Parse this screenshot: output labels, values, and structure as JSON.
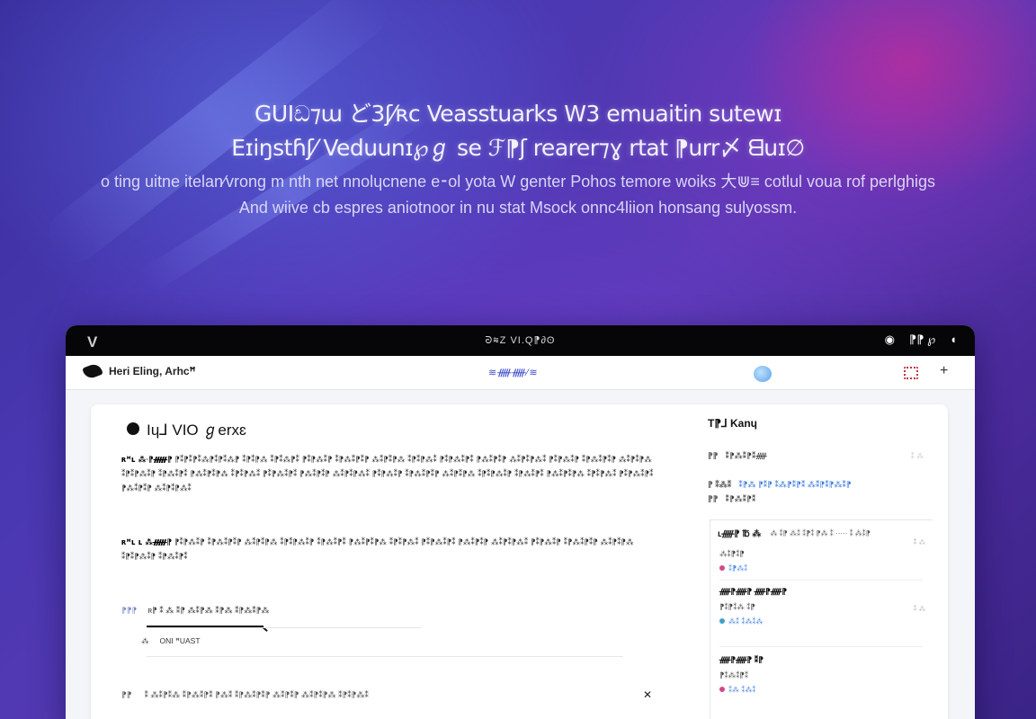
{
  "hero": {
    "headline_line1": "GUIඩ⁊ɯ ど3ʃ⁄ʀс  Veasstuarks W3 emuaitin sutewɪ",
    "headline_line2": "Eɪiŋstɦʃ⁄ Veduunɪ℘ℊ se ℱ⁋ʃ rearer⁊ɣ rtat  ⁋urr〆 ᗺuɪ∅",
    "subtext": "o ting uitne itelan⁄vrong m nth net nnolɥcnene e⁃ol yota W genter Pohos temore woiks 大⋓≡ cotlul voua rof perlghigs And wiive cb espres aniotnoor in nu stat Msock onnc4liion honsang sulyossm."
  },
  "window": {
    "logo": "V",
    "title": "ᘒ≋Z VI.Q⁋∂ʘ",
    "tb_icon_1": "◉",
    "tb_icon_2": "⁋⁋ ℘",
    "tb_icon_3": "◖"
  },
  "appbar": {
    "brand": "Heri Eling, Arhcꟸ",
    "nav_center": "≋ᚏᚏ⁄≋"
  },
  "doc": {
    "title": "Iɥ⅃  VIO ℊerxɛ",
    "para1_lead": "ʀꟸʟ ⁂ᐧ⁋ᚏ⁋",
    "para1": "⁋⁑⁋⁑⁋⁑⁂⁋⁑⁋⁑⁂⁋ ⁑⁋⁑⁋⁂ ⁑⁋⁑⁂⁋⁑ ⁋⁑⁋⁂⁑⁋ ⁑⁋⁂⁑⁋⁑⁋ ⁂⁑⁋⁑⁋⁂ ⁑⁋⁑⁋⁂⁑ ⁋⁑⁋⁂⁑⁋⁑ ⁋⁂⁑⁋⁑⁋ ⁂⁑⁋⁑⁋⁂⁑ ⁋⁑⁋⁂⁑⁋ ⁑⁋⁂⁑⁋⁑⁋ ⁂⁑⁋⁑⁋⁂ ⁑⁋⁑⁋⁂⁑⁋ ⁑⁋⁂⁑⁋⁑ ⁋⁂⁑⁋⁑⁋⁂ ⁑⁋⁑⁋⁂⁑ ⁋⁑⁋⁂⁑⁋⁑ ⁋⁂⁑⁋⁑⁋ ⁂⁑⁋⁑⁋⁂⁑ ⁋⁑⁋⁂⁑⁋ ⁑⁋⁂⁑⁋⁑⁋ ⁂⁑⁋⁑⁋⁂ ⁑⁋⁑⁋⁂⁑⁋ ⁑⁋⁂⁑⁋⁑ ⁋⁂⁑⁋⁑⁋⁂ ⁑⁋⁑⁋⁂⁑ ⁋⁑⁋⁂⁑⁋⁑ ⁋⁂⁑⁋⁑⁋ ⁂⁑⁋⁑⁋⁂⁑",
    "para2_lead": "ʀꟸʟ ʟ ⁂ᚏ⁋",
    "para2": "⁋⁑⁋⁂⁑⁋ ⁑⁋⁂⁑⁋⁑⁋ ⁂⁑⁋⁑⁋⁂ ⁑⁋⁑⁋⁂⁑⁋ ⁑⁋⁂⁑⁋⁑ ⁋⁂⁑⁋⁑⁋⁂ ⁑⁋⁑⁋⁂⁑ ⁋⁑⁋⁂⁑⁋⁑ ⁋⁂⁑⁋⁑⁋ ⁂⁑⁋⁑⁋⁂⁑ ⁋⁑⁋⁂⁑⁋ ⁑⁋⁂⁑⁋⁑⁋ ⁂⁑⁋⁑⁋⁂ ⁑⁋⁑⁋⁂⁑⁋ ⁑⁋⁂⁑⁋⁑",
    "row_a_icon": "⁋⁋⁋",
    "row_a_text": "ʀ⁋ ⁑ ⁂ ⁑⁋ ⁂⁑⁋⁂ ⁑⁋⁂ ⁑⁋⁂⁑⁋⁂",
    "small_row_icon": "⁂",
    "small_row_text": "ONI ꟸUAST",
    "row_b_icon": "⁋⁋",
    "row_b_text": "⁑ ⁂⁑⁋⁑⁂ ⁑⁋⁂⁑⁋⁑ ⁋⁂⁑ ⁑⁋⁂⁑⁋⁑⁋ ⁂⁑⁋⁑⁋ ⁂⁑⁋⁑⁋⁂ ⁑⁋⁑⁋⁂⁑",
    "row_b_close": "✕"
  },
  "sidebar": {
    "title": "T⁋⅃ Kanɥ",
    "kv1_label": "⁋⁋",
    "kv1_value": "⁑⁋⁂⁑⁋⁑ᚏ",
    "kv1_meta": "⁑ ⁂",
    "kv2_label": "⁋ ⁑⁂⁑",
    "kv2_link": "⁑⁋⁂ ⁋⁑⁋ ⁑⁂⁋⁑⁋⁑ ⁂⁑⁋⁑⁋⁂⁑⁋",
    "kv3_label": "⁋⁋",
    "kv3_value": "⁑⁋⁂⁑⁋⁑",
    "panel_head": "ʟᚏ⁋ ℔ ⁂",
    "panel_head_meta": "⁂ ⁑⁋ ⁂⁑ ⁑⁋⁑ ⁋⁂ ⁑ ·····  ⁑  ⁂⁑⁋",
    "items": [
      {
        "title": "",
        "sub": "⁂⁑⁋⁑⁋",
        "tag": "⁑⁋⁂⁑",
        "meta": "⁑ ⁂"
      },
      {
        "title": "ᚏ⁋ᚏ⁋ ᚏ⁋ᚏ⁋",
        "sub": "⁋⁑⁋⁑⁂ ⁑⁋",
        "tag": "⁂⁑ ⁑⁂⁑⁂",
        "meta": "⁑ ⁂"
      },
      {
        "title": "ᚏ⁋ᚏ⁋ ⁑⁋",
        "sub": "⁋⁑⁂⁑⁋⁑",
        "tag": "⁑⁂ ⁑⁂⁑",
        "meta": ""
      }
    ]
  },
  "colors": {
    "accent": "#3d7de0",
    "titlebar": "#060608",
    "bg_violet": "#4a38b2"
  }
}
